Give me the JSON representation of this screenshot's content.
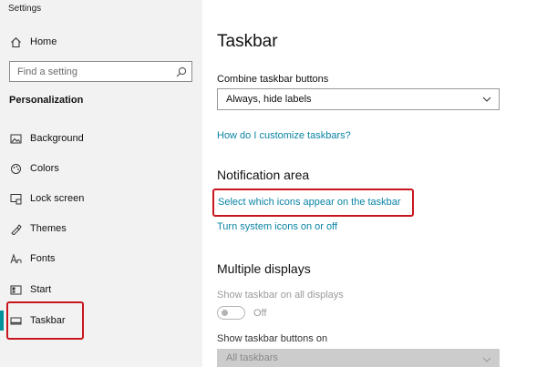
{
  "app": {
    "title": "Settings"
  },
  "sidebar": {
    "home_label": "Home",
    "search": {
      "placeholder": "Find a setting"
    },
    "section_title": "Personalization",
    "items": [
      {
        "label": "Background",
        "icon": "image-icon"
      },
      {
        "label": "Colors",
        "icon": "palette-icon"
      },
      {
        "label": "Lock screen",
        "icon": "lock-screen-icon"
      },
      {
        "label": "Themes",
        "icon": "themes-icon"
      },
      {
        "label": "Fonts",
        "icon": "fonts-icon"
      },
      {
        "label": "Start",
        "icon": "start-icon"
      },
      {
        "label": "Taskbar",
        "icon": "taskbar-icon",
        "selected": true
      }
    ]
  },
  "main": {
    "title": "Taskbar",
    "combine": {
      "label": "Combine taskbar buttons",
      "value": "Always, hide labels"
    },
    "customize_link": "How do I customize taskbars?",
    "notification_area": {
      "heading": "Notification area",
      "select_icons_link": "Select which icons appear on the taskbar",
      "system_icons_link": "Turn system icons on or off"
    },
    "multiple_displays": {
      "heading": "Multiple displays",
      "show_all_label": "Show taskbar on all displays",
      "show_all_state": "Off",
      "buttons_on_label": "Show taskbar buttons on",
      "buttons_on_value": "All taskbars"
    }
  },
  "colors": {
    "accent": "#00939b",
    "link": "#0a84a5",
    "annotation": "#c8161e"
  }
}
